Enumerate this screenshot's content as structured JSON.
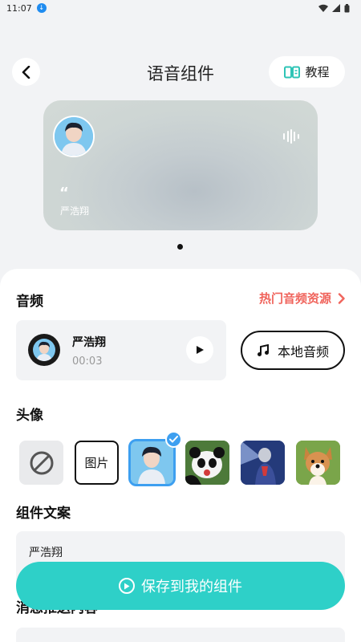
{
  "status_bar": {
    "time": "11:07"
  },
  "header": {
    "title": "语音组件",
    "tutorial_label": "教程"
  },
  "preview": {
    "name": "严浩翔"
  },
  "panel": {
    "audio": {
      "section_title": "音频",
      "hot_link_label": "热门音频资源",
      "track_name": "严浩翔",
      "track_time": "00:03",
      "local_audio_label": "本地音频"
    },
    "avatar": {
      "section_title": "头像",
      "picture_label": "图片"
    },
    "caption": {
      "section_title": "组件文案",
      "value": "严浩翔"
    },
    "notice": {
      "section_title": "消息推送内容"
    }
  },
  "save_button_label": "保存到我的组件",
  "colors": {
    "accent": "#2ed0c8",
    "hot_link": "#f0645c",
    "selected": "#3d9ff0"
  }
}
